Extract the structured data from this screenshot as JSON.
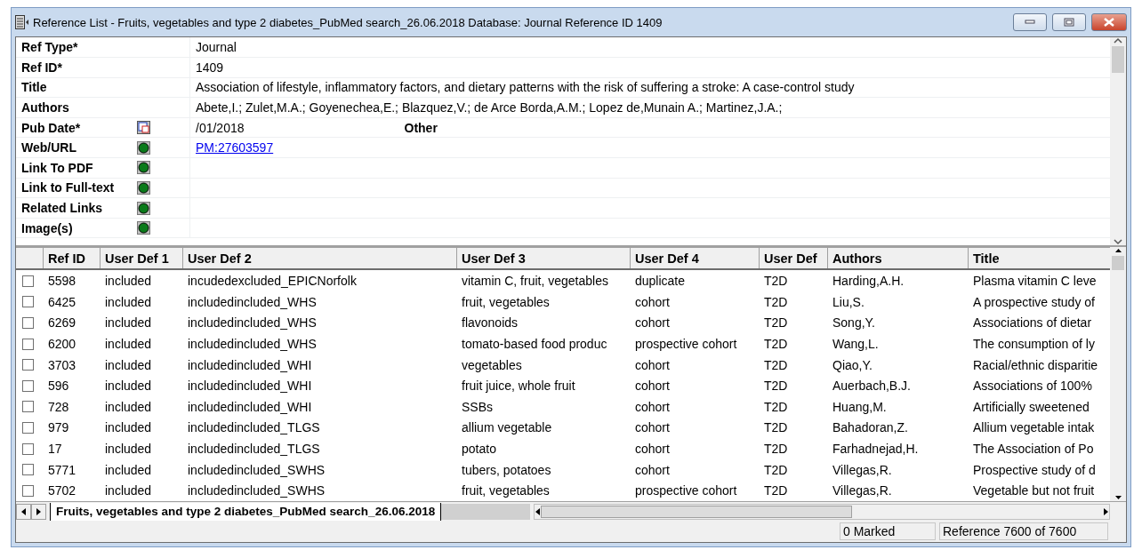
{
  "window": {
    "title": "Reference List - Fruits, vegetables and type 2 diabetes_PubMed search_26.06.2018 Database: Journal Reference ID 1409"
  },
  "fields": [
    {
      "label": "Ref Type*",
      "kind": "text",
      "value": "Journal"
    },
    {
      "label": "Ref ID*",
      "kind": "text",
      "value": "1409"
    },
    {
      "label": "Title",
      "kind": "text",
      "value": "Association of lifestyle, inflammatory factors, and dietary patterns with the risk of suffering a stroke: A case-control study"
    },
    {
      "label": "Authors",
      "kind": "text",
      "value": "Abete,I.; Zulet,M.A.; Goyenechea,E.; Blazquez,V.; de Arce Borda,A.M.; Lopez de,Munain A.; Martinez,J.A.;"
    },
    {
      "label": "Pub Date*",
      "kind": "date",
      "value": " /01/2018",
      "extra": "Other"
    },
    {
      "label": "Web/URL",
      "kind": "link",
      "value": "PM:27603597"
    },
    {
      "label": "Link To PDF",
      "kind": "link"
    },
    {
      "label": "Link to Full-text",
      "kind": "link"
    },
    {
      "label": "Related Links",
      "kind": "link"
    },
    {
      "label": "Image(s)",
      "kind": "link"
    }
  ],
  "table": {
    "columns": [
      "Ref ID",
      "User Def 1",
      "User Def 2",
      "User Def 3",
      "User Def 4",
      "User Def",
      "Authors",
      "Title"
    ],
    "rows": [
      {
        "checked": false,
        "cells": [
          "5598",
          "included",
          "incudedexcluded_EPICNorfolk",
          "vitamin C, fruit, vegetables",
          "duplicate",
          "T2D",
          "Harding,A.H.",
          "Plasma vitamin C leve"
        ]
      },
      {
        "checked": false,
        "cells": [
          "6425",
          "included",
          "includedincluded_WHS",
          "fruit, vegetables",
          "cohort",
          "T2D",
          "Liu,S.",
          "A prospective study of"
        ]
      },
      {
        "checked": false,
        "cells": [
          "6269",
          "included",
          "includedincluded_WHS",
          "flavonoids",
          "cohort",
          "T2D",
          "Song,Y.",
          "Associations of dietar"
        ]
      },
      {
        "checked": false,
        "cells": [
          "6200",
          "included",
          "includedincluded_WHS",
          "tomato-based food produc",
          "prospective cohort",
          "T2D",
          "Wang,L.",
          "The consumption of ly"
        ]
      },
      {
        "checked": false,
        "cells": [
          "3703",
          "included",
          "includedincluded_WHI",
          "vegetables",
          "cohort",
          "T2D",
          "Qiao,Y.",
          "Racial/ethnic disparitie"
        ]
      },
      {
        "checked": false,
        "cells": [
          "596",
          "included",
          "includedincluded_WHI",
          "fruit juice, whole fruit",
          "cohort",
          "T2D",
          "Auerbach,B.J.",
          "Associations of 100%"
        ]
      },
      {
        "checked": false,
        "cells": [
          "728",
          "included",
          "includedincluded_WHI",
          "SSBs",
          "cohort",
          "T2D",
          "Huang,M.",
          "Artificially sweetened"
        ]
      },
      {
        "checked": false,
        "cells": [
          "979",
          "included",
          "includedincluded_TLGS",
          "allium vegetable",
          "cohort",
          "T2D",
          "Bahadoran,Z.",
          "Allium vegetable intak"
        ]
      },
      {
        "checked": false,
        "cells": [
          "17",
          "included",
          "includedincluded_TLGS",
          "potato",
          "cohort",
          "T2D",
          "Farhadnejad,H.",
          "The Association of Po"
        ]
      },
      {
        "checked": false,
        "cells": [
          "5771",
          "included",
          "includedincluded_SWHS",
          "tubers, potatoes",
          "cohort",
          "T2D",
          "Villegas,R.",
          "Prospective study of d"
        ]
      },
      {
        "checked": false,
        "cells": [
          "5702",
          "included",
          "includedincluded_SWHS",
          "fruit, vegetables",
          "prospective cohort",
          "T2D",
          "Villegas,R.",
          "Vegetable but not fruit"
        ]
      }
    ]
  },
  "sheet_tab": {
    "label": "Fruits, vegetables and type 2 diabetes_PubMed search_26.06.2018",
    "selected": true
  },
  "status_bar": {
    "marked": "0 Marked",
    "position": "Reference 7600 of 7600"
  }
}
